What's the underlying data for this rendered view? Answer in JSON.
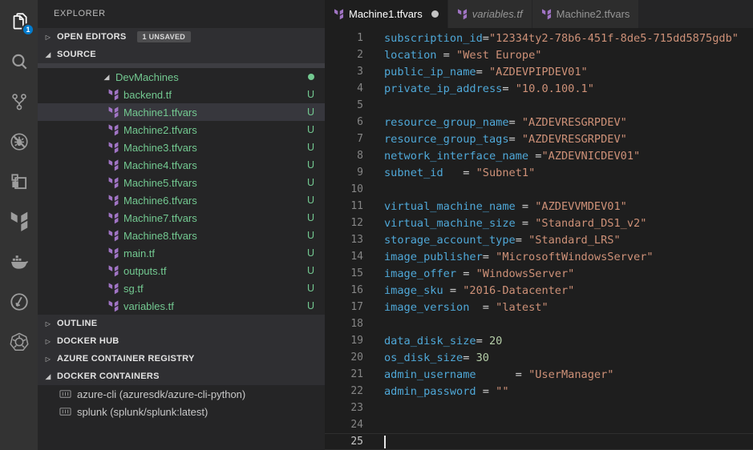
{
  "colors": {
    "accent_blue": "#007acc",
    "untracked_green": "#73c991",
    "terraform_purple": "#a074c4",
    "key_blue": "#4fa8d8",
    "string_orange": "#ce9178",
    "number_green": "#b5cea8"
  },
  "activity_bar": {
    "badge": "1",
    "items": [
      {
        "id": "explorer",
        "icon": "files-icon",
        "active": true,
        "badge": "1"
      },
      {
        "id": "search",
        "icon": "search-icon"
      },
      {
        "id": "source-control",
        "icon": "git-branch-icon"
      },
      {
        "id": "debug-disabled",
        "icon": "bug-off-icon"
      },
      {
        "id": "extensions",
        "icon": "extensions-icon"
      },
      {
        "id": "terraform",
        "icon": "terraform-icon"
      },
      {
        "id": "docker",
        "icon": "docker-icon"
      },
      {
        "id": "gauge",
        "icon": "gauge-icon"
      },
      {
        "id": "kubernetes",
        "icon": "kubernetes-icon"
      }
    ]
  },
  "sidebar": {
    "title": "EXPLORER",
    "open_editors": {
      "label": "OPEN EDITORS",
      "badge": "1 UNSAVED",
      "expanded": false
    },
    "source": {
      "label": "SOURCE",
      "expanded": true
    },
    "tree": [
      {
        "type": "folder",
        "label": "DevMachines",
        "expanded": true,
        "git_dot": true
      },
      {
        "type": "file",
        "label": "backend.tf",
        "git": "U"
      },
      {
        "type": "file",
        "label": "Machine1.tfvars",
        "git": "U",
        "selected": true
      },
      {
        "type": "file",
        "label": "Machine2.tfvars",
        "git": "U"
      },
      {
        "type": "file",
        "label": "Machine3.tfvars",
        "git": "U"
      },
      {
        "type": "file",
        "label": "Machine4.tfvars",
        "git": "U"
      },
      {
        "type": "file",
        "label": "Machine5.tfvars",
        "git": "U"
      },
      {
        "type": "file",
        "label": "Machine6.tfvars",
        "git": "U"
      },
      {
        "type": "file",
        "label": "Machine7.tfvars",
        "git": "U"
      },
      {
        "type": "file",
        "label": "Machine8.tfvars",
        "git": "U"
      },
      {
        "type": "file",
        "label": "main.tf",
        "git": "U"
      },
      {
        "type": "file",
        "label": "outputs.tf",
        "git": "U"
      },
      {
        "type": "file",
        "label": "sg.tf",
        "git": "U"
      },
      {
        "type": "file",
        "label": "variables.tf",
        "git": "U"
      }
    ],
    "sections": [
      {
        "label": "OUTLINE",
        "expanded": false
      },
      {
        "label": "DOCKER HUB",
        "expanded": false
      },
      {
        "label": "AZURE CONTAINER REGISTRY",
        "expanded": false
      },
      {
        "label": "DOCKER CONTAINERS",
        "expanded": true
      }
    ],
    "containers": [
      {
        "label": "azure-cli (azuresdk/azure-cli-python)"
      },
      {
        "label": "splunk (splunk/splunk:latest)"
      }
    ]
  },
  "editor": {
    "tabs": [
      {
        "label": "Machine1.tfvars",
        "active": true,
        "dirty": true
      },
      {
        "label": "variables.tf",
        "preview": true
      },
      {
        "label": "Machine2.tfvars"
      }
    ],
    "cursor_line": 25,
    "lines": [
      {
        "n": 1,
        "tokens": [
          {
            "t": "k",
            "v": "subscription_id"
          },
          {
            "t": "o",
            "v": "="
          },
          {
            "t": "s",
            "v": "\"12334ty2-78b6-451f-8de5-715dd5875gdb\""
          }
        ]
      },
      {
        "n": 2,
        "tokens": [
          {
            "t": "k",
            "v": "location"
          },
          {
            "t": "o",
            "v": " = "
          },
          {
            "t": "s",
            "v": "\"West Europe\""
          }
        ]
      },
      {
        "n": 3,
        "tokens": [
          {
            "t": "k",
            "v": "public_ip_name"
          },
          {
            "t": "o",
            "v": "= "
          },
          {
            "t": "s",
            "v": "\"AZDEVPIPDEV01\""
          }
        ]
      },
      {
        "n": 4,
        "tokens": [
          {
            "t": "k",
            "v": "private_ip_address"
          },
          {
            "t": "o",
            "v": "= "
          },
          {
            "t": "s",
            "v": "\"10.0.100.1\""
          }
        ]
      },
      {
        "n": 5,
        "tokens": []
      },
      {
        "n": 6,
        "tokens": [
          {
            "t": "k",
            "v": "resource_group_name"
          },
          {
            "t": "o",
            "v": "= "
          },
          {
            "t": "s",
            "v": "\"AZDEVRESGRPDEV\""
          }
        ]
      },
      {
        "n": 7,
        "tokens": [
          {
            "t": "k",
            "v": "resource_group_tags"
          },
          {
            "t": "o",
            "v": "= "
          },
          {
            "t": "s",
            "v": "\"AZDEVRESGRPDEV\""
          }
        ]
      },
      {
        "n": 8,
        "tokens": [
          {
            "t": "k",
            "v": "network_interface_name"
          },
          {
            "t": "o",
            "v": " ="
          },
          {
            "t": "s",
            "v": "\"AZDEVNICDEV01\""
          }
        ]
      },
      {
        "n": 9,
        "tokens": [
          {
            "t": "k",
            "v": "subnet_id"
          },
          {
            "t": "o",
            "v": "   = "
          },
          {
            "t": "s",
            "v": "\"Subnet1\""
          }
        ]
      },
      {
        "n": 10,
        "tokens": []
      },
      {
        "n": 11,
        "tokens": [
          {
            "t": "k",
            "v": "virtual_machine_name"
          },
          {
            "t": "o",
            "v": " = "
          },
          {
            "t": "s",
            "v": "\"AZDEVVMDEV01\""
          }
        ]
      },
      {
        "n": 12,
        "tokens": [
          {
            "t": "k",
            "v": "virtual_machine_size"
          },
          {
            "t": "o",
            "v": " = "
          },
          {
            "t": "s",
            "v": "\"Standard_DS1_v2\""
          }
        ]
      },
      {
        "n": 13,
        "tokens": [
          {
            "t": "k",
            "v": "storage_account_type"
          },
          {
            "t": "o",
            "v": "= "
          },
          {
            "t": "s",
            "v": "\"Standard_LRS\""
          }
        ]
      },
      {
        "n": 14,
        "tokens": [
          {
            "t": "k",
            "v": "image_publisher"
          },
          {
            "t": "o",
            "v": "= "
          },
          {
            "t": "s",
            "v": "\"MicrosoftWindowsServer\""
          }
        ]
      },
      {
        "n": 15,
        "tokens": [
          {
            "t": "k",
            "v": "image_offer"
          },
          {
            "t": "o",
            "v": " = "
          },
          {
            "t": "s",
            "v": "\"WindowsServer\""
          }
        ]
      },
      {
        "n": 16,
        "tokens": [
          {
            "t": "k",
            "v": "image_sku"
          },
          {
            "t": "o",
            "v": " = "
          },
          {
            "t": "s",
            "v": "\"2016-Datacenter\""
          }
        ]
      },
      {
        "n": 17,
        "tokens": [
          {
            "t": "k",
            "v": "image_version"
          },
          {
            "t": "o",
            "v": "  = "
          },
          {
            "t": "s",
            "v": "\"latest\""
          }
        ]
      },
      {
        "n": 18,
        "tokens": []
      },
      {
        "n": 19,
        "tokens": [
          {
            "t": "k",
            "v": "data_disk_size"
          },
          {
            "t": "o",
            "v": "= "
          },
          {
            "t": "n",
            "v": "20"
          }
        ]
      },
      {
        "n": 20,
        "tokens": [
          {
            "t": "k",
            "v": "os_disk_size"
          },
          {
            "t": "o",
            "v": "= "
          },
          {
            "t": "n",
            "v": "30"
          }
        ]
      },
      {
        "n": 21,
        "tokens": [
          {
            "t": "k",
            "v": "admin_username"
          },
          {
            "t": "o",
            "v": "      = "
          },
          {
            "t": "s",
            "v": "\"UserManager\""
          }
        ]
      },
      {
        "n": 22,
        "tokens": [
          {
            "t": "k",
            "v": "admin_password"
          },
          {
            "t": "o",
            "v": " = "
          },
          {
            "t": "s",
            "v": "\"\""
          }
        ]
      },
      {
        "n": 23,
        "tokens": []
      },
      {
        "n": 24,
        "tokens": []
      },
      {
        "n": 25,
        "tokens": []
      }
    ]
  }
}
